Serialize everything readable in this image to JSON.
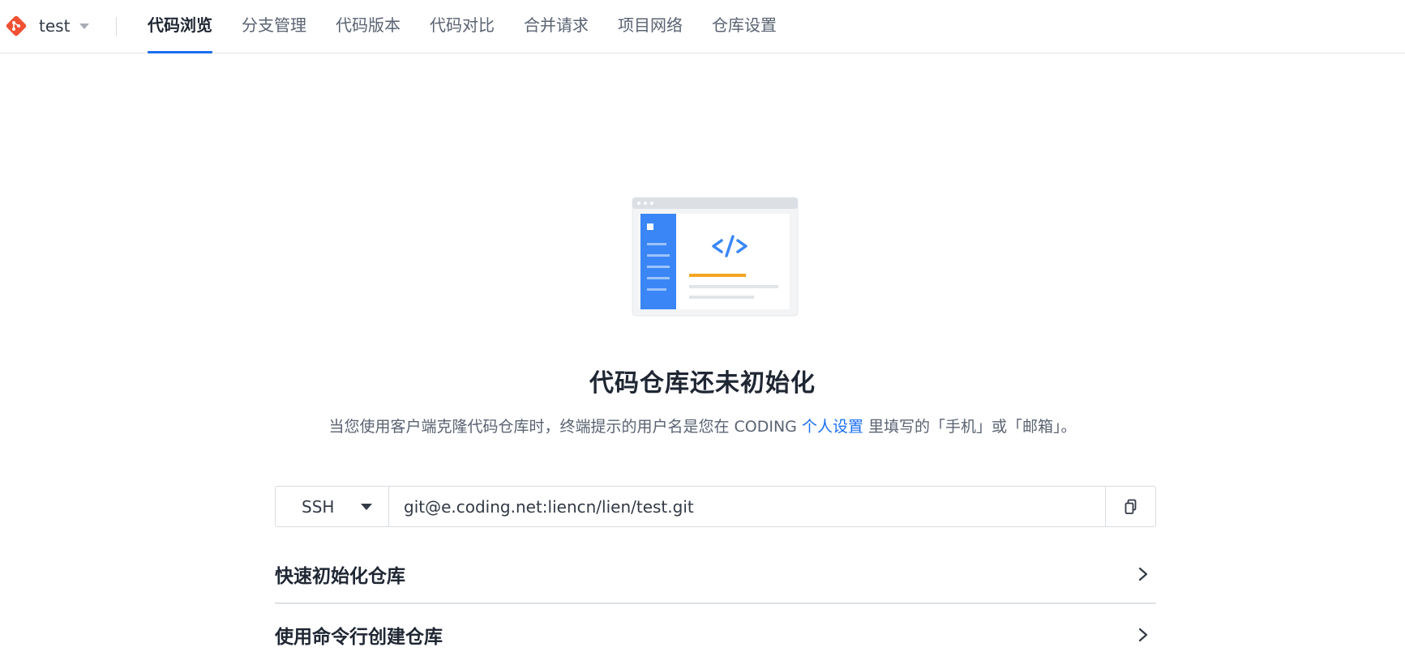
{
  "header": {
    "repo_name": "test",
    "tabs": [
      {
        "label": "代码浏览",
        "active": true
      },
      {
        "label": "分支管理",
        "active": false
      },
      {
        "label": "代码版本",
        "active": false
      },
      {
        "label": "代码对比",
        "active": false
      },
      {
        "label": "合并请求",
        "active": false
      },
      {
        "label": "项目网络",
        "active": false
      },
      {
        "label": "仓库设置",
        "active": false
      }
    ]
  },
  "empty_state": {
    "title": "代码仓库还未初始化",
    "desc_before": "当您使用客户端克隆代码仓库时，终端提示的用户名是您在 CODING ",
    "desc_link": "个人设置",
    "desc_after": " 里填写的「手机」或「邮箱」。"
  },
  "clone": {
    "protocol": "SSH",
    "url": "git@e.coding.net:liencn/lien/test.git"
  },
  "sections": [
    {
      "title": "快速初始化仓库"
    },
    {
      "title": "使用命令行创建仓库"
    }
  ],
  "colors": {
    "accent": "#1b6ff0",
    "git_logo": "#f05033",
    "illustration_blue": "#3a86f7",
    "illustration_orange": "#f5a623"
  },
  "icons": {
    "repo": "git-logo-icon",
    "copy": "copy-icon",
    "expand": "chevron-right-icon"
  }
}
